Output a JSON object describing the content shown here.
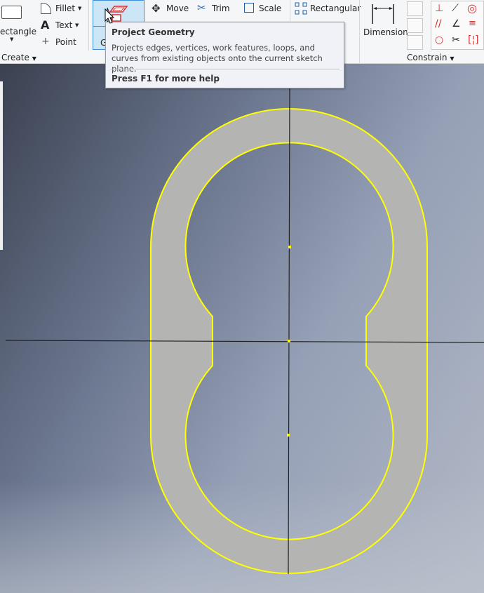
{
  "ribbon": {
    "create": {
      "rectangle_label": "ectangle",
      "fillet_label": "Fillet",
      "text_label": "Text",
      "point_label": "Point",
      "panel_label": "Create",
      "project_label": "G"
    },
    "modify": {
      "move_label": "Move",
      "trim_label": "Trim",
      "scale_label": "Scale"
    },
    "pattern": {
      "rectangular_label": "Rectangular"
    },
    "constrain": {
      "dimension_label": "Dimension",
      "panel_label": "Constrain"
    }
  },
  "tooltip": {
    "title": "Project Geometry",
    "description": "Projects edges, vertices, work features, loops, and curves from existing objects onto the current sketch plane.",
    "help": "Press F1 for more help"
  },
  "colors": {
    "sketch": "#ffff00",
    "profile_fill": "#b4b4b2",
    "accent": "#d32f2f"
  }
}
